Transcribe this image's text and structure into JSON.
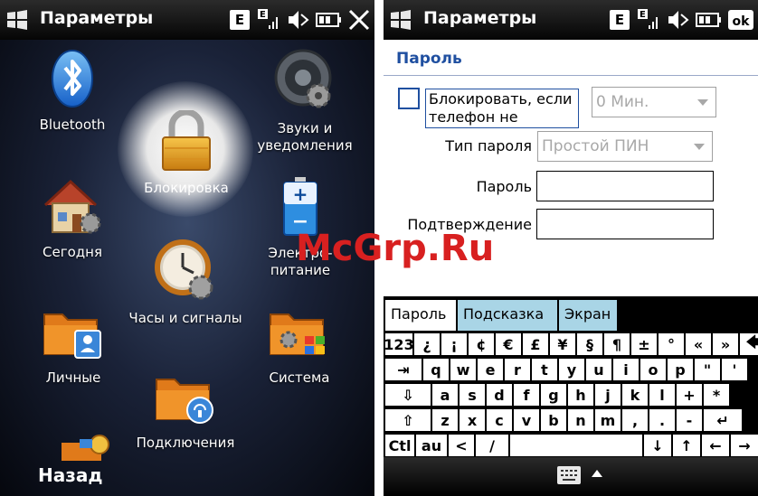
{
  "left": {
    "title": "Параметры",
    "status": {
      "network_badge": "E",
      "signal_badge": "E"
    },
    "tiles": [
      {
        "name": "bluetooth",
        "label": "Bluetooth"
      },
      {
        "name": "sounds",
        "label": "Звуки и\nуведомления"
      },
      {
        "name": "lock",
        "label": "Блокировка"
      },
      {
        "name": "today",
        "label": "Сегодня"
      },
      {
        "name": "power",
        "label": "Электро-\nпитание"
      },
      {
        "name": "clock",
        "label": "Часы и сигналы"
      },
      {
        "name": "personal",
        "label": "Личные"
      },
      {
        "name": "system",
        "label": "Система"
      },
      {
        "name": "connections",
        "label": "Подключения"
      }
    ],
    "back_label": "Назад"
  },
  "right": {
    "title": "Параметры",
    "status": {
      "network_badge": "E",
      "signal_badge": "E"
    },
    "heading": "Пароль",
    "lock_checkbox_label": "Блокировать, если телефон не",
    "lock_time_value": "0 Мин.",
    "password_type_label": "Тип пароля",
    "password_type_value": "Простой ПИН",
    "password_label": "Пароль",
    "confirm_label": "Подтверждение",
    "tabs": [
      "Пароль",
      "Подсказка",
      "Экран"
    ],
    "keyboard": {
      "row1": [
        "123",
        "¿",
        "¡",
        "¢",
        "€",
        "£",
        "¥",
        "§",
        "¶",
        "±",
        "°",
        "«",
        "»",
        "🡄"
      ],
      "row2": [
        "⇥",
        "q",
        "w",
        "e",
        "r",
        "t",
        "y",
        "u",
        "i",
        "o",
        "p",
        "\"",
        "'"
      ],
      "row3": [
        "⇩",
        "a",
        "s",
        "d",
        "f",
        "g",
        "h",
        "j",
        "k",
        "l",
        "+",
        "*"
      ],
      "row4": [
        "⇧",
        "z",
        "x",
        "c",
        "v",
        "b",
        "n",
        "m",
        ",",
        ".",
        "-",
        "↵"
      ],
      "row5": [
        "Ctl",
        "au",
        "<",
        "/",
        "↓",
        "↑",
        "←",
        "→"
      ]
    }
  },
  "watermark": "McGrp.Ru",
  "colors": {
    "accent": "#1f4fa0",
    "tab_inactive": "#a9d5e6",
    "watermark": "#d82020"
  }
}
